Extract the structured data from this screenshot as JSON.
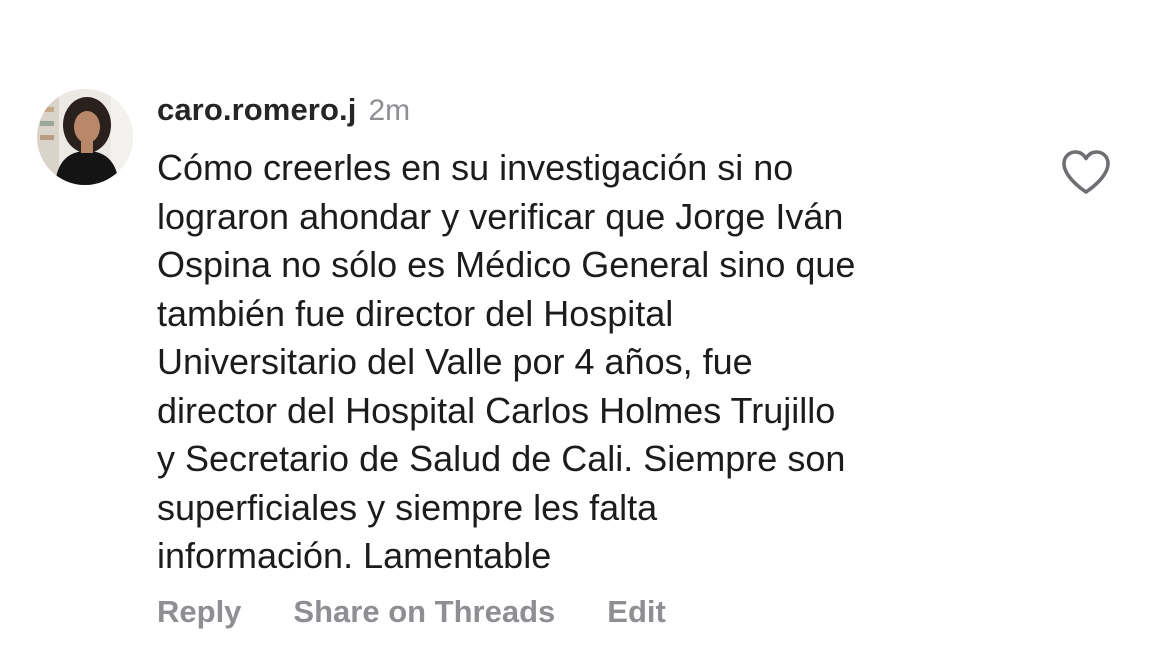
{
  "comment": {
    "avatar_icon": "profile-photo",
    "username": "caro.romero.j",
    "time": "2m",
    "text_lines": [
      "Cómo creerles en su investigación si no",
      "lograron ahondar y verificar que Jorge Iván",
      "Ospina no sólo es Médico General sino que",
      "también fue director del Hospital",
      "Universitario del Valle por 4 años, fue",
      "director del Hospital Carlos Holmes Trujillo",
      "y Secretario de Salud de Cali. Siempre son",
      "superficiales y siempre les falta",
      "información. Lamentable"
    ],
    "like_icon": "heart-outline-icon"
  },
  "actions": {
    "reply": "Reply",
    "share": "Share on Threads",
    "edit": "Edit"
  },
  "colors": {
    "text": "#1c1c1e",
    "muted": "#8e8e93",
    "background": "#ffffff"
  }
}
